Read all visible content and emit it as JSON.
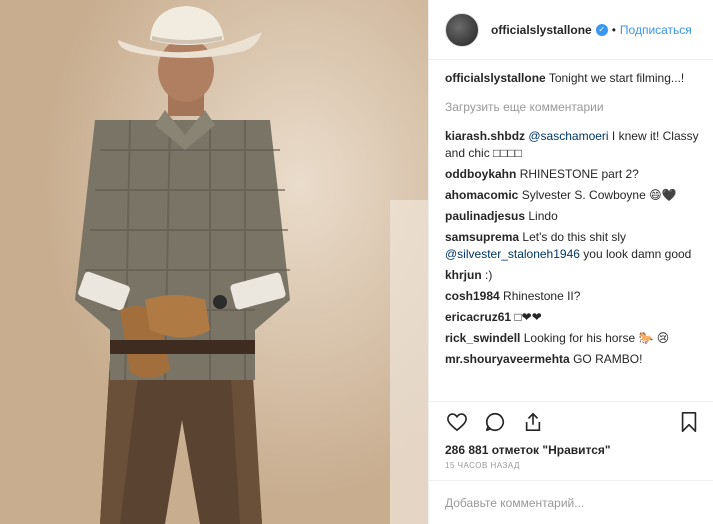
{
  "header": {
    "username": "officialslystallone",
    "separator": "•",
    "follow_label": "Подписаться"
  },
  "caption": {
    "username": "officialslystallone",
    "text": "Tonight we start filming...!"
  },
  "load_more_label": "Загрузить еще комментарии",
  "comments": [
    {
      "user": "kiarash.shbdz",
      "mention": "@saschamoeri",
      "text": " I knew it! Classy and chic □□□□"
    },
    {
      "user": "oddboykahn",
      "mention": "",
      "text": "RHINESTONE part 2?"
    },
    {
      "user": "ahomacomic",
      "mention": "",
      "text": "Sylvester S. Cowboyne 😄🖤"
    },
    {
      "user": "paulinadjesus",
      "mention": "",
      "text": "Lindo"
    },
    {
      "user": "samsuprema",
      "mention": "",
      "text": "Let's do this shit sly"
    },
    {
      "user": "khrjun",
      "mention": "",
      "text": ":)"
    },
    {
      "user": "cosh1984",
      "mention": "",
      "text": "Rhinestone II?"
    },
    {
      "user": "ericacruz61",
      "mention": "",
      "text": "□❤❤"
    },
    {
      "user": "rick_swindell",
      "mention": "",
      "text": "Looking for his horse 🐎 😢"
    },
    {
      "user": "mr.shouryaveermehta",
      "mention": "",
      "text": "GO RAMBO!"
    }
  ],
  "samsuprema_extra": {
    "mention": "@silvester_staloneh1946",
    "text": " you look damn good"
  },
  "likes_text": "286 881 отметок \"Нравится\"",
  "time_text": "15 часов назад",
  "add_comment_placeholder": "Добавьте комментарий...",
  "icons": {
    "like": "heart-icon",
    "comment": "comment-icon",
    "share": "share-icon",
    "save": "bookmark-icon"
  },
  "colors": {
    "link": "#3897f0",
    "mention": "#003569",
    "muted": "#999999"
  }
}
